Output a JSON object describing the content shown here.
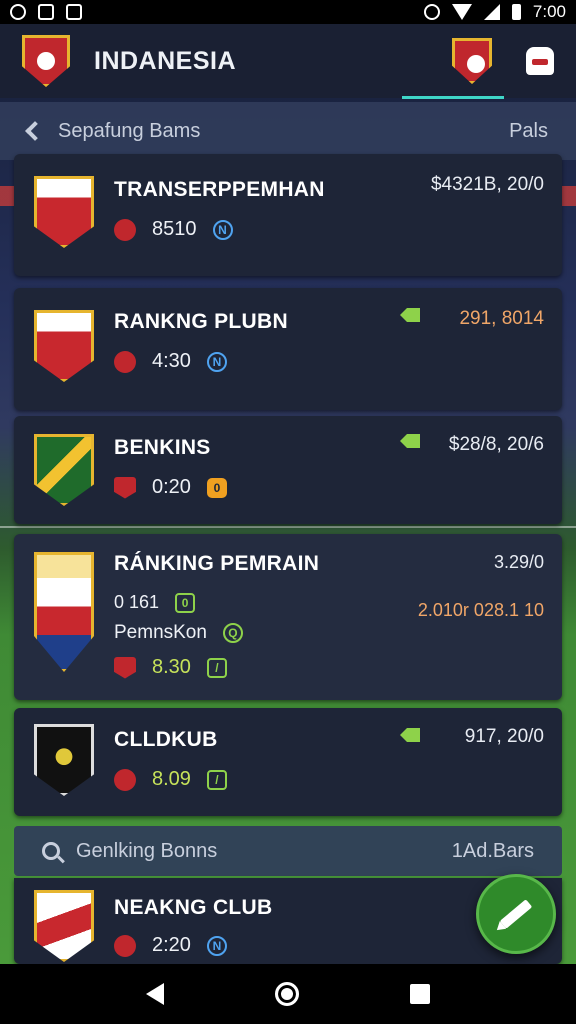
{
  "status_bar": {
    "time": "7:00"
  },
  "header": {
    "title": "INDANESIA"
  },
  "section_top": {
    "title": "Sepafung Bams",
    "right_label": "Pals"
  },
  "cards": [
    {
      "name": "TRANSERPPEMHAN",
      "amount": "$4321B, 20/0",
      "stat": "8510"
    },
    {
      "name": "RANKNG PLUBN",
      "amount": "291, 8014",
      "stat": "4:30"
    },
    {
      "name": "BENKINS",
      "amount": "$28/8, 20/6",
      "stat": "0:20"
    },
    {
      "name": "RÁNKING PEMRAIN",
      "top_right": "3.29/0",
      "sub_stat": "0 161",
      "sub_name": "PemnsKon",
      "amount": "2.010r 028.1 10",
      "stat": "8.30"
    },
    {
      "name": "CLLDKUB",
      "amount": "917, 20/0",
      "stat": "8.09"
    },
    {
      "name": "NEAKNG CLUB",
      "stat": "2:20"
    }
  ],
  "section_bottom": {
    "title": "Genlking Bonns",
    "right_label": "1Ad.Bars"
  },
  "colors": {
    "accent": "#3fd6c8",
    "fab": "#2f8a2a",
    "brand_red": "#c0272d"
  }
}
